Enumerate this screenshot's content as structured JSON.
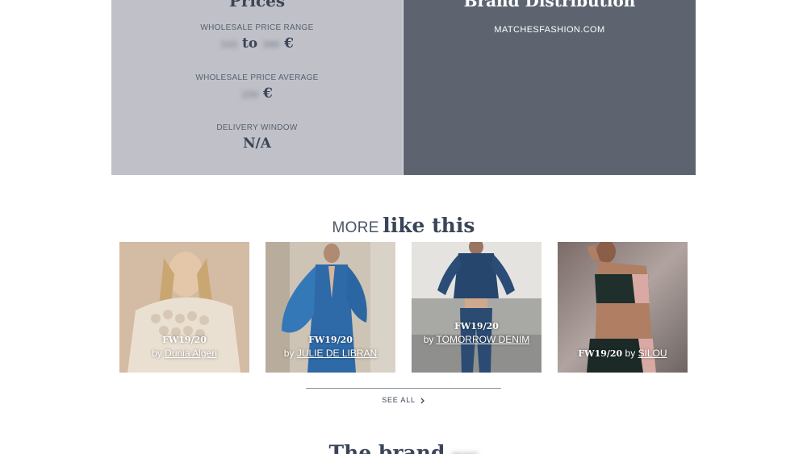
{
  "prices_panel": {
    "title": "Prices",
    "wholesale_range": {
      "label": "WHOLESALE PRICE RANGE",
      "min_blurred": "103",
      "to_word": "to",
      "max_blurred": "390",
      "currency": "€"
    },
    "wholesale_average": {
      "label": "WHOLESALE PRICE AVERAGE",
      "value_blurred": "250",
      "currency": "€"
    },
    "delivery_window": {
      "label": "DELIVERY WINDOW",
      "value": "N/A"
    },
    "background_color": "#c0c1c8"
  },
  "brand_panel": {
    "title": "Brand Distribution",
    "retailer": "MATCHESFASHION.COM",
    "background_color": "#5d6470"
  },
  "more_like_this": {
    "heading_small": "MORE",
    "heading_big": "like this",
    "cards": [
      {
        "season": "FW19/20",
        "by": "by",
        "designer": "Dunia Algeri"
      },
      {
        "season": "FW19/20",
        "by": "by",
        "designer": "JULIE DE LIBRAN"
      },
      {
        "season": "FW19/20",
        "by": "by",
        "designer": "TOMORROW DENIM"
      },
      {
        "season": "FW19/20",
        "by": "by",
        "designer": "SILOU"
      }
    ],
    "see_all_label": "SEE ALL",
    "see_all_icon": "chevron-right-icon"
  },
  "bottom_heading": {
    "text": "The brand",
    "blurred_tail": "way"
  }
}
